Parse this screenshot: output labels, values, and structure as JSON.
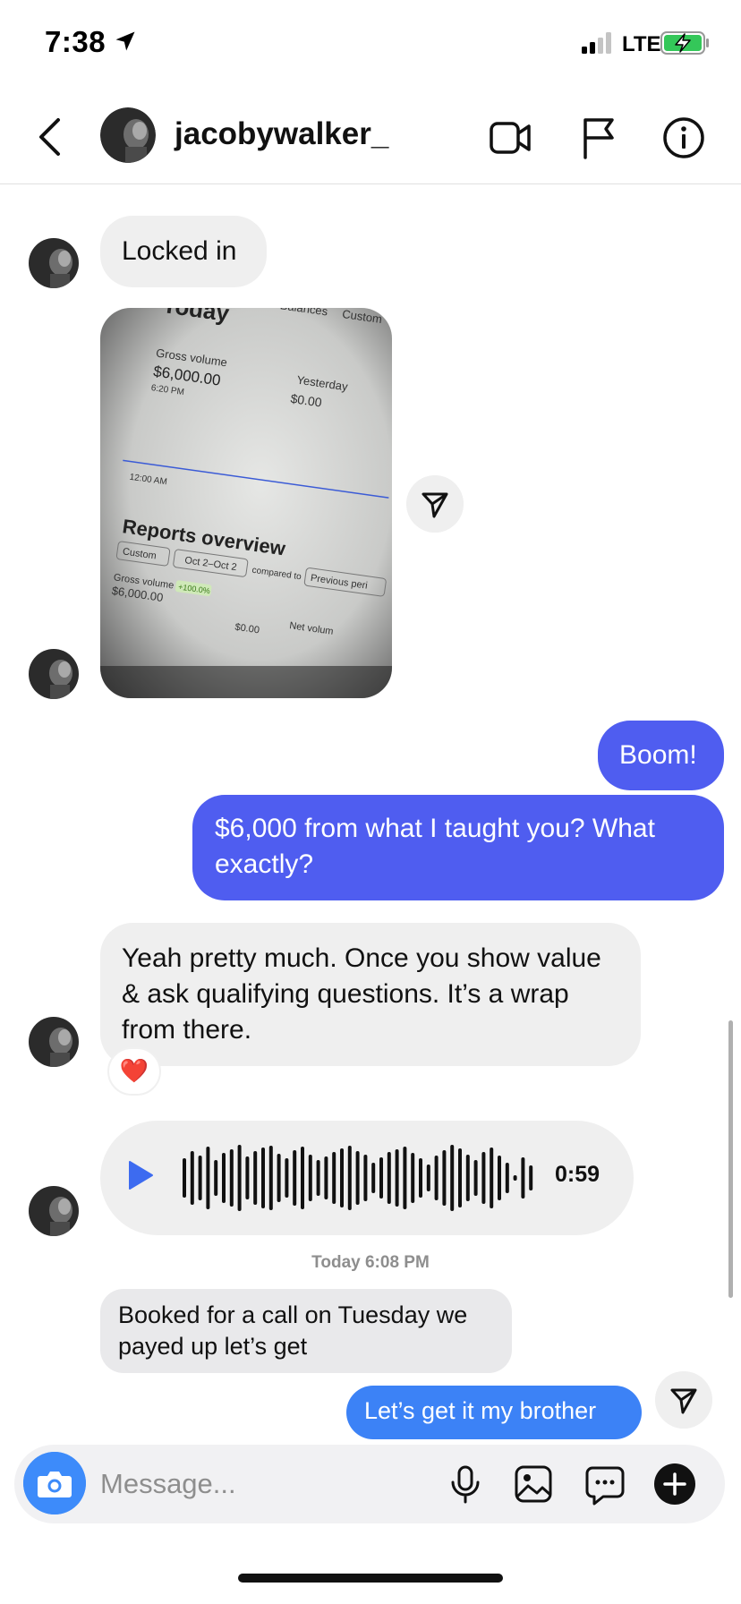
{
  "status_bar": {
    "time": "7:38",
    "network": "LTE"
  },
  "header": {
    "username": "jacobywalker_"
  },
  "messages": {
    "locked_in": "Locked in",
    "boom": "Boom!",
    "six_thousand": "$6,000 from what I taught you? What exactly?",
    "yeah_pretty_much": "Yeah pretty much. Once you show value & ask qualifying questions. It’s a wrap from there.",
    "reaction": "❤️",
    "voice_duration": "0:59",
    "timestamp": "Today 6:08 PM",
    "booked": "Booked for a call on Tuesday we payed up let’s get",
    "lets_get_it": "Let’s get it my brother"
  },
  "photo": {
    "tabs": [
      "Balances",
      "Custom"
    ],
    "today": "Today",
    "gross_volume_label": "Gross volume",
    "gross_volume_value": "$6,000.00",
    "gross_time": "6:20 PM",
    "yesterday_label": "Yesterday",
    "yesterday_value": "$0.00",
    "axis_time": "12:00 AM",
    "reports_title": "Reports overview",
    "filter_custom": "Custom",
    "filter_date": "Oct 2–Oct 2",
    "compared_to": "compared to",
    "previous_period": "Previous peri",
    "gross2_label": "Gross volume",
    "gross2_badge": "+100.0%",
    "gross2_value": "$6,000.00",
    "zero": "$0.00",
    "net_volume": "Net volum"
  },
  "composer": {
    "placeholder": "Message..."
  },
  "colors": {
    "outgoing": "#4f5df0",
    "incoming": "#efefef",
    "blue_bubble": "#3c82f6",
    "camera": "#3d8bfa"
  },
  "icons": [
    "location-arrow-icon",
    "signal-icon",
    "battery-charging-icon",
    "back-chevron-icon",
    "video-camera-icon",
    "flag-icon",
    "info-icon",
    "share-send-icon",
    "play-icon",
    "camera-icon",
    "microphone-icon",
    "gallery-icon",
    "chat-bubble-icon",
    "plus-icon"
  ]
}
